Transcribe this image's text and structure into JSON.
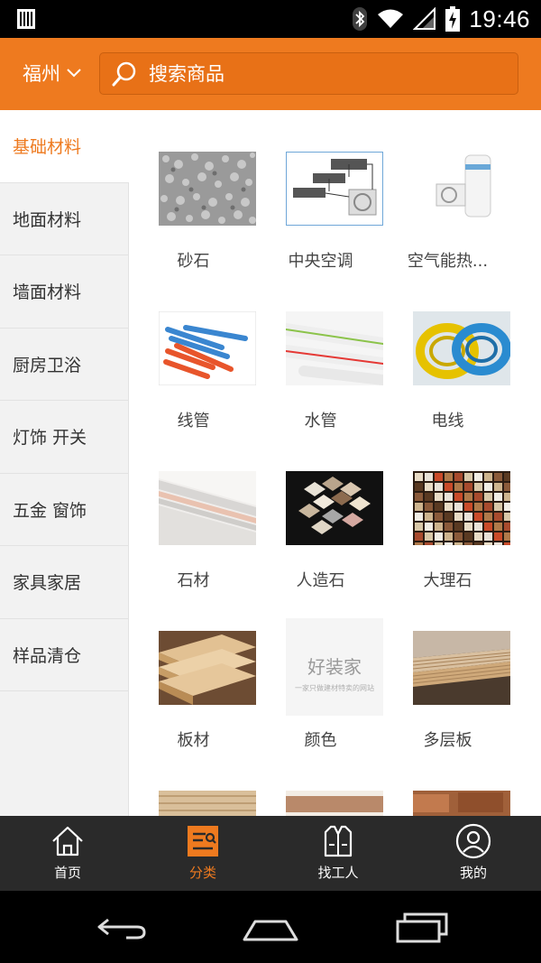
{
  "status_bar": {
    "time": "19:46"
  },
  "header": {
    "city": "福州",
    "search_placeholder": "搜索商品"
  },
  "sidebar": {
    "items": [
      {
        "label": "基础材料",
        "active": true
      },
      {
        "label": "地面材料",
        "active": false
      },
      {
        "label": "墙面材料",
        "active": false
      },
      {
        "label": "厨房卫浴",
        "active": false
      },
      {
        "label": "灯饰 开关",
        "active": false
      },
      {
        "label": "五金 窗饰",
        "active": false
      },
      {
        "label": "家具家居",
        "active": false
      },
      {
        "label": "样品清仓",
        "active": false
      }
    ]
  },
  "products": [
    {
      "label": "砂石"
    },
    {
      "label": "中央空调"
    },
    {
      "label": "空气能热..."
    },
    {
      "label": "线管"
    },
    {
      "label": "水管"
    },
    {
      "label": "电线"
    },
    {
      "label": "石材"
    },
    {
      "label": "人造石"
    },
    {
      "label": "大理石"
    },
    {
      "label": "板材"
    },
    {
      "label": "颜色"
    },
    {
      "label": "多层板"
    }
  ],
  "placeholder_logo": {
    "brand": "好装家",
    "tagline": "一家只做建材特卖的网站"
  },
  "tabbar": {
    "tabs": [
      {
        "label": "首页",
        "active": false
      },
      {
        "label": "分类",
        "active": true
      },
      {
        "label": "找工人",
        "active": false
      },
      {
        "label": "我的",
        "active": false
      }
    ]
  },
  "colors": {
    "accent": "#ee7a1f",
    "tabbar_bg": "#2a2a2a",
    "sidebar_bg": "#f2f2f2"
  }
}
